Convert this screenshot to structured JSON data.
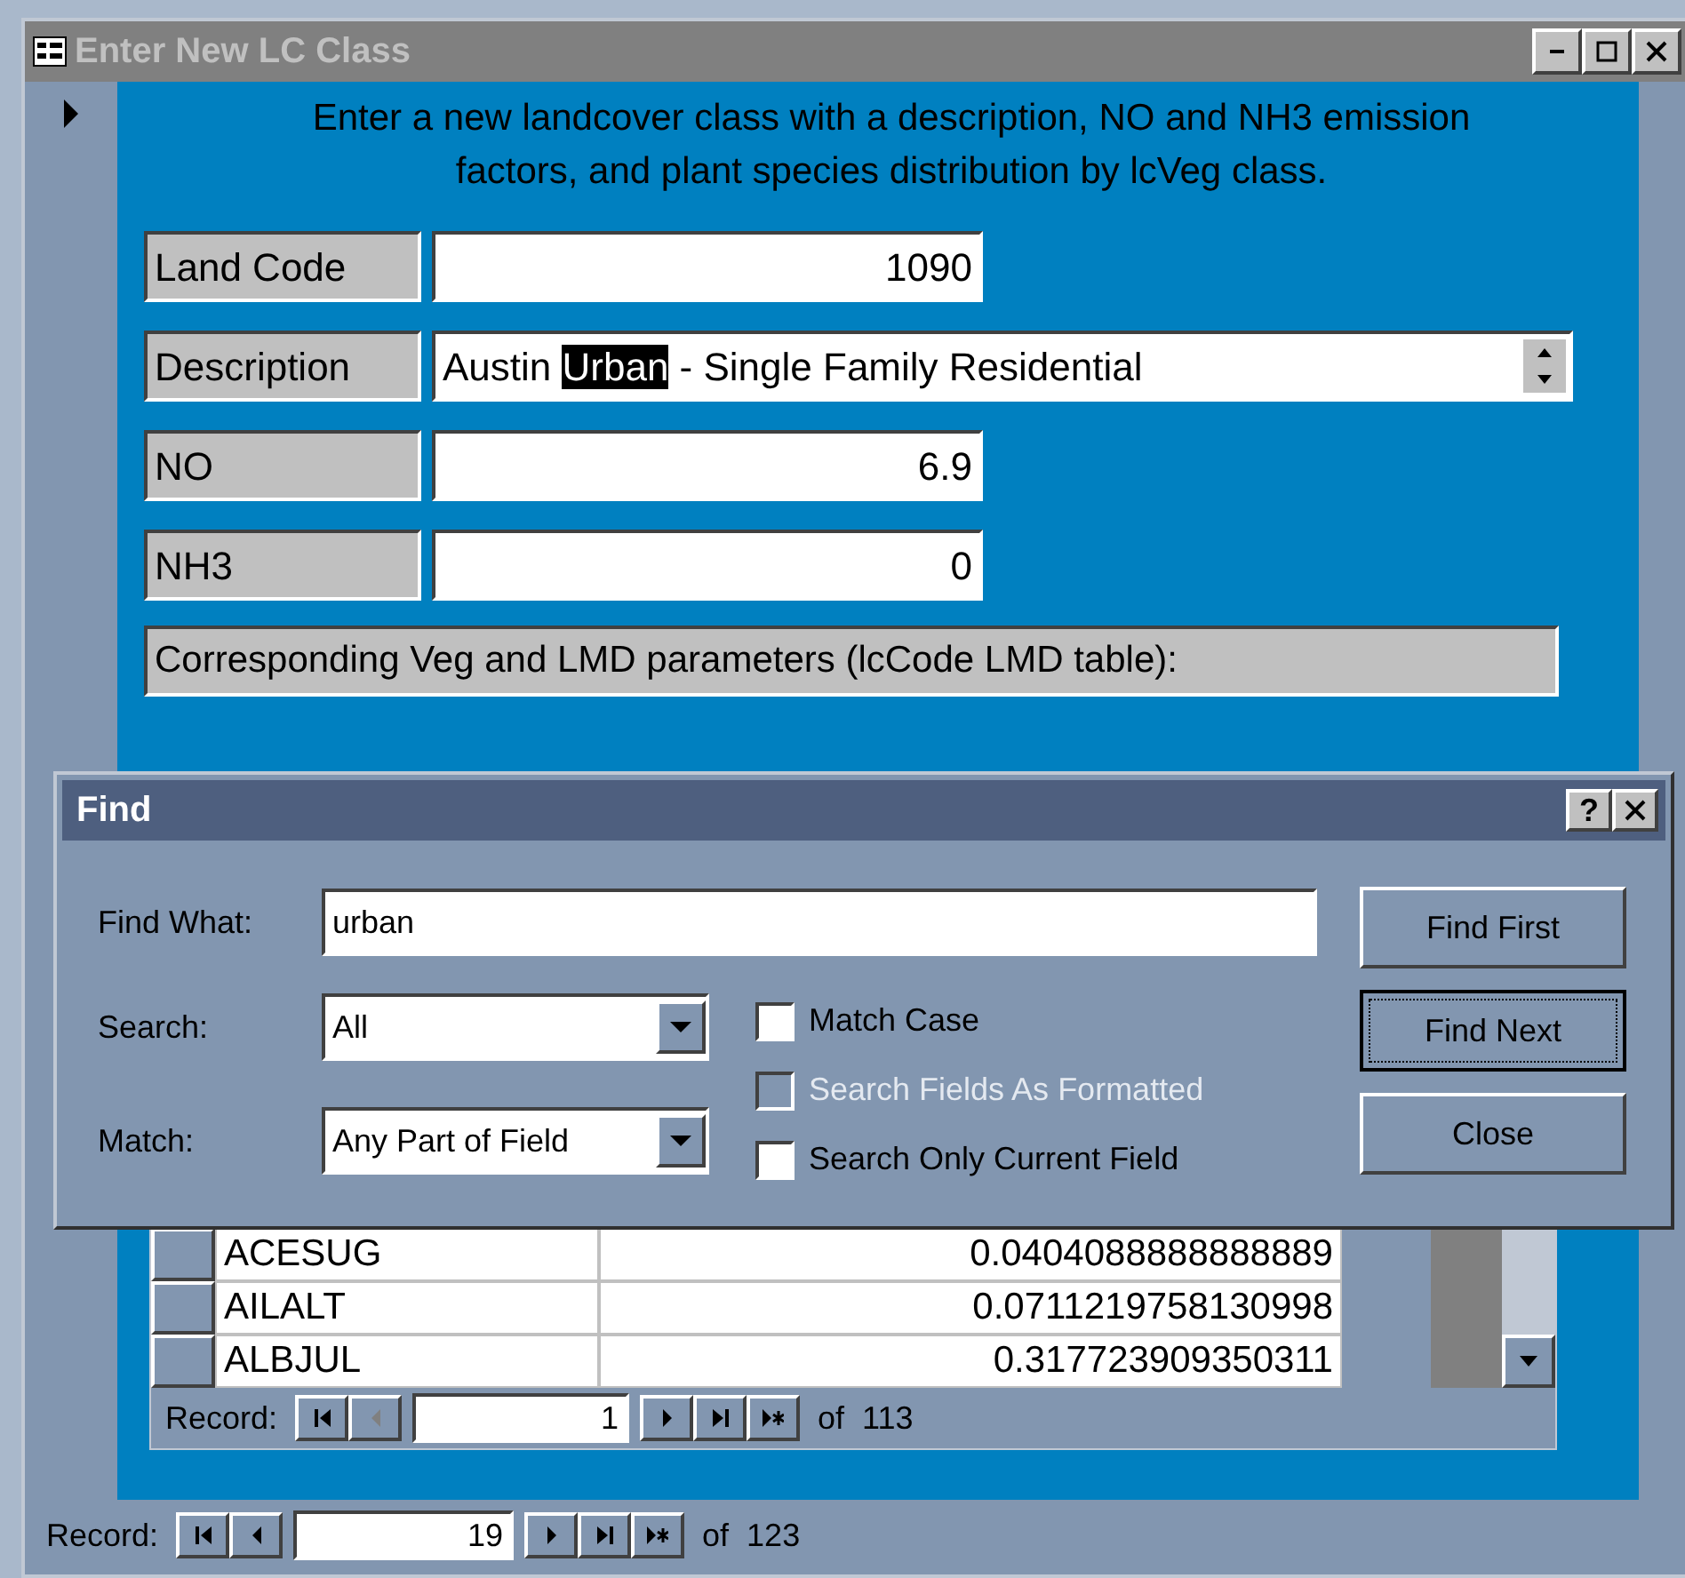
{
  "window": {
    "title": "Enter New LC Class"
  },
  "intro": "Enter a new landcover class with a description, NO and NH3 emission factors, and plant species distribution by lcVeg class.",
  "fields": [
    {
      "label": "Land Code",
      "kind": "number",
      "value": "1090"
    },
    {
      "label": "Description",
      "kind": "memo",
      "before": "Austin ",
      "highlighted": "Urban",
      "after": " - Single Family Residential"
    },
    {
      "label": "NO",
      "kind": "number",
      "value": "6.9"
    },
    {
      "label": "NH3",
      "kind": "number",
      "value": "0"
    }
  ],
  "subform_title": "Corresponding Veg and LMD parameters (lcCode LMD table):",
  "subform": {
    "rows": [
      {
        "code": "ACESUG",
        "value": "0.0404088888888889"
      },
      {
        "code": "AILALT",
        "value": "0.0711219758130998"
      },
      {
        "code": "ALBJUL",
        "value": "0.317723909350311"
      }
    ],
    "nav": {
      "label": "Record:",
      "current": "1",
      "total": "of  113",
      "prev_disabled": true
    }
  },
  "nav": {
    "label": "Record:",
    "current": "19",
    "total": "of  123",
    "prev_disabled": false
  },
  "find": {
    "title": "Find",
    "help": "?",
    "find_what": {
      "label": "Find What:",
      "value": "urban"
    },
    "search": {
      "label": "Search:",
      "value": "All"
    },
    "match": {
      "label": "Match:",
      "value": "Any Part of Field"
    },
    "options": [
      {
        "label": "Match Case",
        "checked": false,
        "disabled": false
      },
      {
        "label": "Search Fields As Formatted",
        "checked": false,
        "disabled": true
      },
      {
        "label": "Search Only Current Field",
        "checked": false,
        "disabled": false
      }
    ],
    "buttons": [
      {
        "label": "Find First",
        "selected": false
      },
      {
        "label": "Find Next",
        "selected": true
      },
      {
        "label": "Close",
        "selected": false
      }
    ]
  }
}
